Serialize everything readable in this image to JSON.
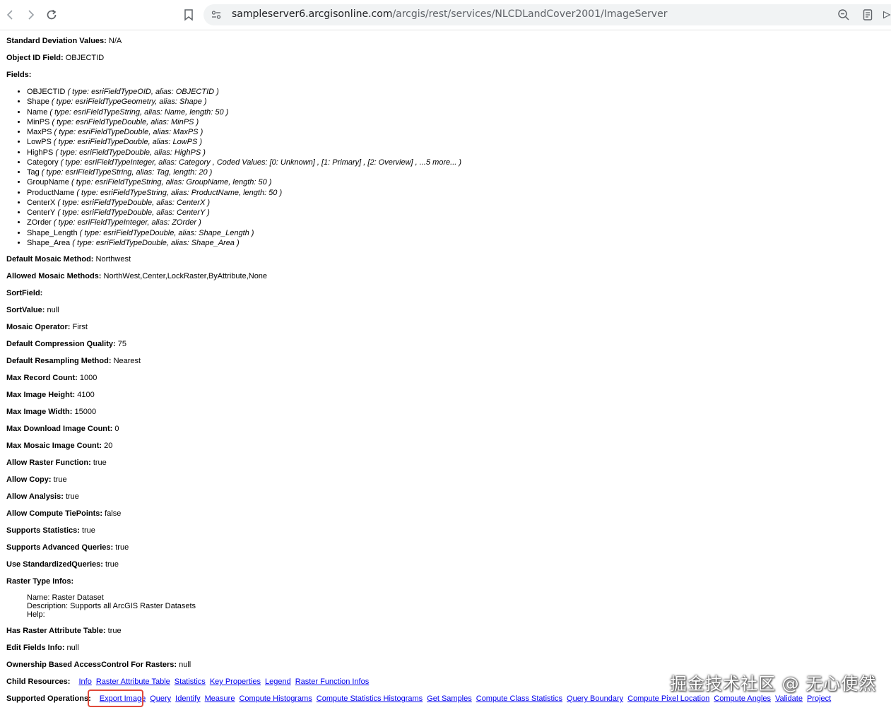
{
  "browser": {
    "url_host": "sampleserver6.arcgisonline.com",
    "url_path": "/arcgis/rest/services/NLCDLandCover2001/ImageServer"
  },
  "props_top": [
    {
      "label": "Standard Deviation Values:",
      "value": " N/A"
    },
    {
      "label": "Object ID Field:",
      "value": " OBJECTID"
    },
    {
      "label": "Fields:",
      "value": ""
    }
  ],
  "fields": [
    {
      "name": "OBJECTID",
      "detail": " ( type: esriFieldTypeOID, alias: OBJECTID )"
    },
    {
      "name": "Shape",
      "detail": " ( type: esriFieldTypeGeometry, alias: Shape )"
    },
    {
      "name": "Name",
      "detail": " ( type: esriFieldTypeString, alias: Name, length: 50 )"
    },
    {
      "name": "MinPS",
      "detail": " ( type: esriFieldTypeDouble, alias: MinPS )"
    },
    {
      "name": "MaxPS",
      "detail": " ( type: esriFieldTypeDouble, alias: MaxPS )"
    },
    {
      "name": "LowPS",
      "detail": " ( type: esriFieldTypeDouble, alias: LowPS )"
    },
    {
      "name": "HighPS",
      "detail": " ( type: esriFieldTypeDouble, alias: HighPS )"
    },
    {
      "name": "Category",
      "detail": " ( type: esriFieldTypeInteger, alias: Category , Coded Values: [0: Unknown] , [1: Primary] , [2: Overview] , ...5 more... )"
    },
    {
      "name": "Tag",
      "detail": " ( type: esriFieldTypeString, alias: Tag, length: 20 )"
    },
    {
      "name": "GroupName",
      "detail": " ( type: esriFieldTypeString, alias: GroupName, length: 50 )"
    },
    {
      "name": "ProductName",
      "detail": " ( type: esriFieldTypeString, alias: ProductName, length: 50 )"
    },
    {
      "name": "CenterX",
      "detail": " ( type: esriFieldTypeDouble, alias: CenterX )"
    },
    {
      "name": "CenterY",
      "detail": " ( type: esriFieldTypeDouble, alias: CenterY )"
    },
    {
      "name": "ZOrder",
      "detail": " ( type: esriFieldTypeInteger, alias: ZOrder )"
    },
    {
      "name": "Shape_Length",
      "detail": " ( type: esriFieldTypeDouble, alias: Shape_Length )"
    },
    {
      "name": "Shape_Area",
      "detail": " ( type: esriFieldTypeDouble, alias: Shape_Area )"
    }
  ],
  "props": [
    {
      "label": "Default Mosaic Method:",
      "value": " Northwest"
    },
    {
      "label": "Allowed Mosaic Methods:",
      "value": " NorthWest,Center,LockRaster,ByAttribute,None"
    },
    {
      "label": "SortField:",
      "value": ""
    },
    {
      "label": "SortValue:",
      "value": " null"
    },
    {
      "label": "Mosaic Operator:",
      "value": " First"
    },
    {
      "label": "Default Compression Quality:",
      "value": " 75"
    },
    {
      "label": "Default Resampling Method:",
      "value": " Nearest"
    },
    {
      "label": "Max Record Count:",
      "value": " 1000"
    },
    {
      "label": "Max Image Height:",
      "value": " 4100"
    },
    {
      "label": "Max Image Width:",
      "value": " 15000"
    },
    {
      "label": "Max Download Image Count:",
      "value": " 0"
    },
    {
      "label": "Max Mosaic Image Count:",
      "value": " 20"
    },
    {
      "label": "Allow Raster Function:",
      "value": " true"
    },
    {
      "label": "Allow Copy:",
      "value": " true"
    },
    {
      "label": "Allow Analysis:",
      "value": " true"
    },
    {
      "label": "Allow Compute TiePoints:",
      "value": " false"
    },
    {
      "label": "Supports Statistics:",
      "value": " true"
    },
    {
      "label": "Supports Advanced Queries:",
      "value": " true"
    },
    {
      "label": "Use StandardizedQueries:",
      "value": " true"
    },
    {
      "label": "Raster Type Infos:",
      "value": ""
    }
  ],
  "raster_type": {
    "name": "Name: Raster Dataset",
    "description": "Description: Supports all ArcGIS Raster Datasets",
    "help": "Help:"
  },
  "props_bottom": [
    {
      "label": "Has Raster Attribute Table:",
      "value": " true"
    },
    {
      "label": "Edit Fields Info:",
      "value": " null"
    },
    {
      "label": "Ownership Based AccessControl For Rasters:",
      "value": " null"
    }
  ],
  "child_resources": {
    "label": "Child Resources:",
    "links": [
      "Info",
      "Raster Attribute Table",
      "Statistics",
      "Key Properties",
      "Legend",
      "Raster Function Infos"
    ]
  },
  "supported_operations": {
    "label": "Supported Operations:",
    "links": [
      "Export Image",
      "Query",
      "Identify",
      "Measure",
      "Compute Histograms",
      "Compute Statistics Histograms",
      "Get Samples",
      "Compute Class Statistics",
      "Query Boundary",
      "Compute Pixel Location",
      "Compute Angles",
      "Validate",
      "Project"
    ]
  },
  "watermark": "掘金技术社区 @ 无心使然",
  "colors": {
    "link": "#0000ee",
    "highlight": "#e0493a"
  }
}
